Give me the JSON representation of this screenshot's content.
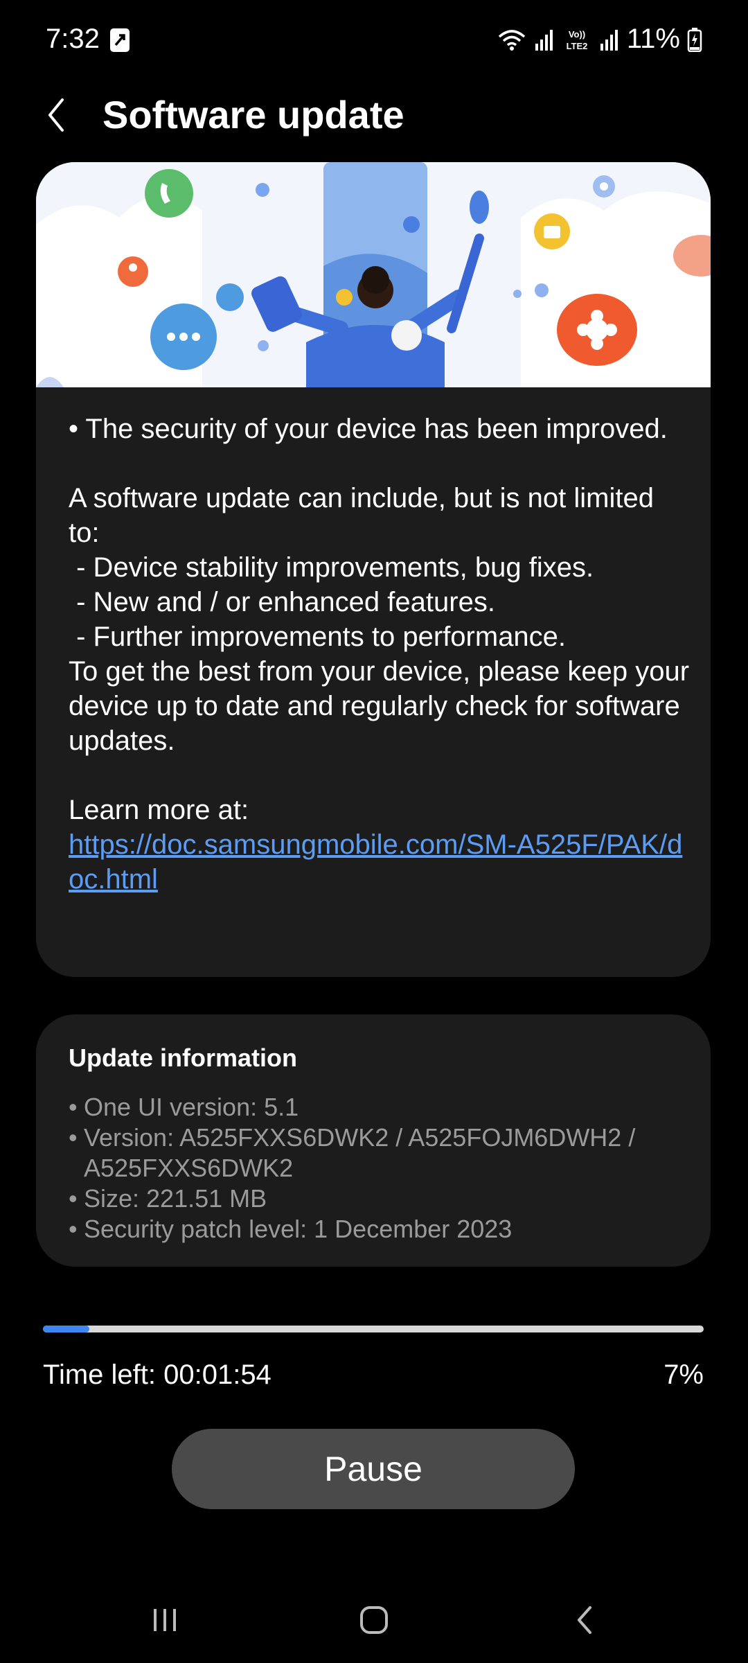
{
  "status_bar": {
    "time": "7:32",
    "battery": "11%",
    "icons": [
      "upload-icon",
      "wifi-icon",
      "signal-icon",
      "volte-icon",
      "signal-icon",
      "battery-charging-icon"
    ]
  },
  "header": {
    "back_icon": "chevron-left-icon",
    "title": "Software update"
  },
  "notes": {
    "security_line": "• The security of your device has been improved.",
    "intro": "A software update can include, but is not limited to:",
    "items": [
      " - Device stability improvements, bug fixes.",
      " - New and / or enhanced features.",
      " - Further improvements to performance."
    ],
    "keep_updated": "To get the best from your device, please keep your device up to date and regularly check for software updates.",
    "learn_more": "Learn more at:",
    "link": "https://doc.samsungmobile.com/SM-A525F/PAK/doc.html"
  },
  "update_info": {
    "title": "Update information",
    "items": [
      "One UI version: 5.1",
      "Version: A525FXXS6DWK2 / A525FOJM6DWH2 / A525FXXS6DWK2",
      "Size: 221.51 MB",
      "Security patch level: 1 December 2023"
    ]
  },
  "download": {
    "progress_percent": 7,
    "time_left": "Time left: 00:01:54",
    "percent_label": "7%",
    "pause_label": "Pause"
  },
  "nav_bar": {
    "icons": [
      "recents-icon",
      "home-icon",
      "back-icon"
    ]
  },
  "colors": {
    "background": "#000000",
    "card": "#1c1c1c",
    "link": "#5b9cf5",
    "progress": "#3e86f0",
    "button": "#4a4a4a"
  }
}
